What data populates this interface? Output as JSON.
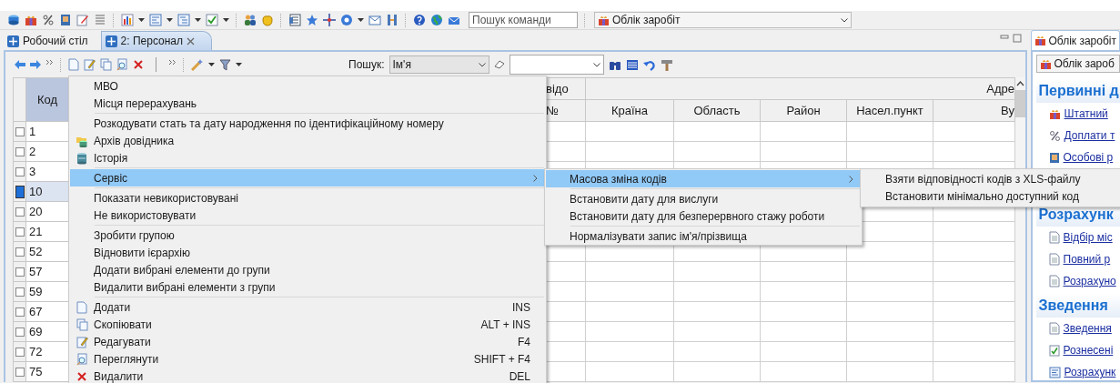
{
  "toolbar": {
    "command_search": {
      "placeholder": "Пошук команди"
    },
    "module_select": {
      "value": "Облік заробіт"
    }
  },
  "tabs": [
    {
      "label": "Робочий стіл",
      "selected": false,
      "closable": false
    },
    {
      "label": "2: Персонал",
      "selected": true,
      "closable": true
    }
  ],
  "list_toolbar": {
    "search_label": "Пошук:",
    "search_by": {
      "value": "Ім'я"
    }
  },
  "table": {
    "key_column": "Код",
    "top_headers": [
      "відо",
      "Адре"
    ],
    "columns": [
      "№",
      "Країна",
      "Область",
      "Район",
      "Насел.пункт",
      "Ву"
    ],
    "rows": [
      {
        "code": "1",
        "selected": false
      },
      {
        "code": "2",
        "selected": false
      },
      {
        "code": "3",
        "selected": false
      },
      {
        "code": "10",
        "selected": true
      },
      {
        "code": "20",
        "selected": false
      },
      {
        "code": "21",
        "selected": false
      },
      {
        "code": "52",
        "selected": false
      },
      {
        "code": "57",
        "selected": false
      },
      {
        "code": "59",
        "selected": false
      },
      {
        "code": "67",
        "selected": false
      },
      {
        "code": "69",
        "selected": false
      },
      {
        "code": "72",
        "selected": false
      },
      {
        "code": "75",
        "selected": false
      }
    ]
  },
  "context_menu": {
    "groups": [
      [
        {
          "label": "МВО",
          "selected": false,
          "submenu": false
        },
        {
          "label": "Місця перерахувань",
          "selected": false,
          "submenu": false
        }
      ],
      [
        {
          "label": "Розкодувати стать та дату народження по ідентифікаційному номеру",
          "selected": false,
          "submenu": false
        },
        {
          "label": "Архів довідника",
          "kind": "archive",
          "selected": false,
          "submenu": false
        },
        {
          "label": "Історія",
          "kind": "history",
          "selected": false,
          "submenu": false
        }
      ],
      [
        {
          "label": "Сервіс",
          "selected": true,
          "submenu": true
        }
      ],
      [
        {
          "label": "Показати невикористовувані",
          "selected": false,
          "submenu": false
        },
        {
          "label": "Не використовувати",
          "selected": false,
          "submenu": false
        }
      ],
      [
        {
          "label": "Зробити групою",
          "selected": false,
          "submenu": false
        },
        {
          "label": "Відновити ієрархію",
          "selected": false,
          "submenu": false
        },
        {
          "label": "Додати вибрані елементи до групи",
          "selected": false,
          "submenu": false
        },
        {
          "label": "Видалити вибрані елементи з групи",
          "selected": false,
          "submenu": false
        }
      ],
      [
        {
          "label": "Додати",
          "kind": "add",
          "shortcut": "INS",
          "selected": false,
          "submenu": false
        },
        {
          "label": "Скопіювати",
          "kind": "copy",
          "shortcut": "ALT + INS",
          "selected": false,
          "submenu": false
        },
        {
          "label": "Редагувати",
          "kind": "edit",
          "shortcut": "F4",
          "selected": false,
          "submenu": false
        },
        {
          "label": "Переглянути",
          "kind": "view",
          "shortcut": "SHIFT + F4",
          "selected": false,
          "submenu": false
        },
        {
          "label": "Видалити",
          "kind": "delete",
          "shortcut": "DEL",
          "selected": false,
          "submenu": false
        }
      ]
    ]
  },
  "service_submenu": {
    "groups": [
      [
        {
          "label": "Масова зміна кодів",
          "selected": true,
          "submenu": true
        }
      ],
      [
        {
          "label": "Встановити дату для вислуги",
          "selected": false,
          "submenu": false
        },
        {
          "label": "Встановити дату для безперервного стажу роботи",
          "selected": false,
          "submenu": false
        }
      ],
      [
        {
          "label": "Нормалізувати запис ім'я/прізвища",
          "selected": false,
          "submenu": false
        }
      ]
    ]
  },
  "codes_submenu": {
    "groups": [
      [
        {
          "label": "Взяти відповідності кодів з XLS-файлу",
          "selected": false
        },
        {
          "label": "Встановити мінімально доступний код",
          "selected": false
        }
      ]
    ]
  },
  "side_panel": {
    "tab": "Облік заробіт",
    "select": {
      "value": "Облік зароб"
    },
    "sections": [
      {
        "title": "Первинні д",
        "links": [
          {
            "label": "Штатний ",
            "kind": "gift"
          },
          {
            "label": "Доплати т",
            "kind": "percent"
          },
          {
            "label": "Особові р",
            "kind": "card"
          }
        ]
      },
      {
        "title": "Розрахунк",
        "links": [
          {
            "label": "Відбір міс",
            "kind": "doc"
          },
          {
            "label": "Повний р",
            "kind": "doc"
          },
          {
            "label": "Розрахуно",
            "kind": "doc"
          }
        ]
      },
      {
        "title": "Зведення",
        "links": [
          {
            "label": "Зведення ",
            "kind": "doc"
          },
          {
            "label": "Рознесені",
            "kind": "check"
          },
          {
            "label": "Розрахунк",
            "kind": "form"
          }
        ]
      }
    ]
  }
}
